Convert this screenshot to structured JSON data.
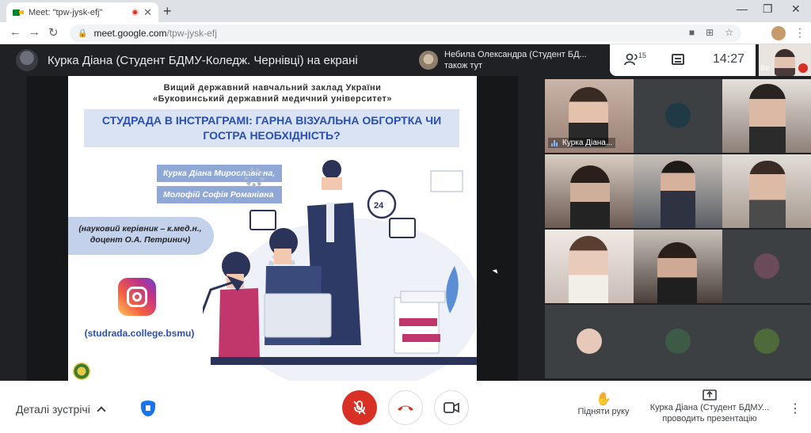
{
  "browser": {
    "tab_title": "Meet: \"tpw-jysk-efj\"",
    "url_host": "meet.google.com",
    "url_path": "/tpw-jysk-efj",
    "new_tab": "+",
    "minimize": "—",
    "maximize": "❐",
    "close": "✕"
  },
  "meeting": {
    "presenting_title": "Курка Діана (Студент БДМУ-Коледж. Чернівці) на екрані",
    "notification_name": "Небила Олександра (Студент БД...",
    "notification_sub": "також тут",
    "participant_count": "15",
    "clock": "14:27",
    "self_label": "Ви"
  },
  "slide": {
    "head_line1": "Вищий державний навчальний заклад України",
    "head_line2": "«Буковинський державний медичний університет»",
    "title": "СТУДРАДА В ІНСТРАГРАМІ: ГАРНА ВІЗУАЛЬНА ОБГОРТКА ЧИ ГОСТРА НЕОБХІДНІСТЬ?",
    "author1": "Курка Діана Мирославівна,",
    "author2": "Молофій Софія Романівна",
    "advisor": "(науковий керівник – к.мед.н., доцент О.А. Петринич)",
    "handle": "(studrada.college.bsmu)",
    "badge_24": "24"
  },
  "tiles": [
    {
      "label": "Курка Діана...",
      "speaking": true,
      "highlighted": true,
      "avatar_color": "#d8b8a8"
    },
    {
      "label": "",
      "avatar_color": "#1f3a44"
    },
    {
      "label": "",
      "avatar_color": "#d7bfb0"
    },
    {
      "label": "",
      "avatar_color": "#c2a898"
    },
    {
      "label": "",
      "avatar_color": "#cdb7a4"
    },
    {
      "label": "",
      "avatar_color": "#d1b4a2"
    },
    {
      "label": "",
      "avatar_color": "#e2ccc0"
    },
    {
      "label": "",
      "avatar_color": "#b89c8e"
    },
    {
      "label": "",
      "avatar_color": "#6b4a5a"
    },
    {
      "label": "",
      "avatar_color": "#e6c9b8"
    },
    {
      "label": "",
      "avatar_color": "#3c5a46"
    },
    {
      "label": "",
      "avatar_color": "#4f6a3a"
    }
  ],
  "controls": {
    "meeting_details": "Деталі зустрічі",
    "raise_hand": "Підняти руку",
    "presenter_line1": "Курка Діана (Студент БДМУ...",
    "presenter_line2": "проводить презентацію"
  },
  "colors": {
    "accent_red": "#d93025",
    "accent_blue": "#1a73e8",
    "slide_title_blue": "#2a4fb0"
  }
}
